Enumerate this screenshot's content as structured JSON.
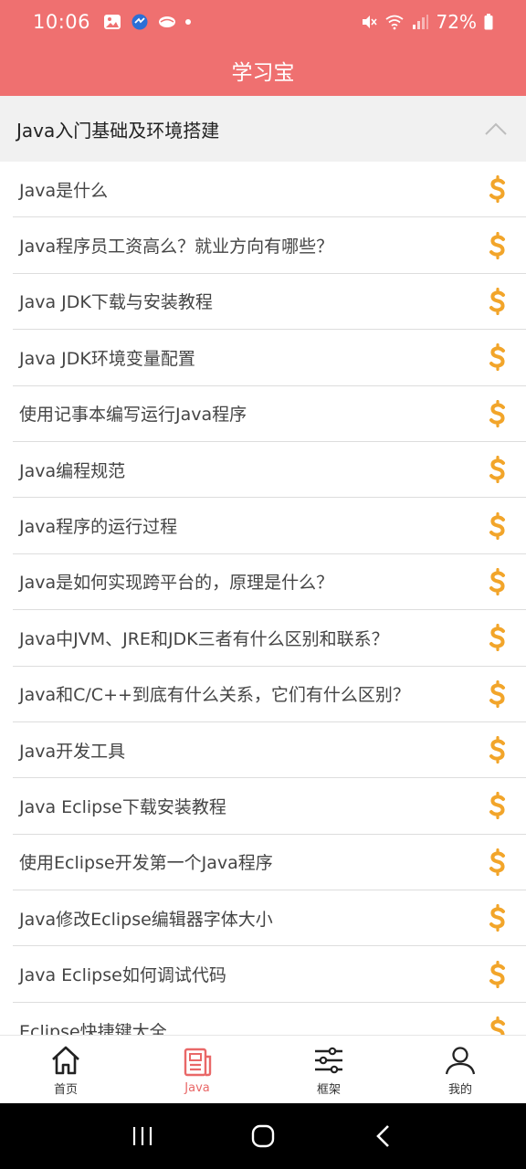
{
  "status_bar": {
    "time": "10:06",
    "battery": "72%"
  },
  "title": "学习宝",
  "section": {
    "title": "Java入门基础及环境搭建"
  },
  "items": [
    {
      "label": "Java是什么"
    },
    {
      "label": "Java程序员工资高么？就业方向有哪些？"
    },
    {
      "label": "Java JDK下载与安装教程"
    },
    {
      "label": "Java JDK环境变量配置"
    },
    {
      "label": "使用记事本编写运行Java程序"
    },
    {
      "label": "Java编程规范"
    },
    {
      "label": "Java程序的运行过程"
    },
    {
      "label": "Java是如何实现跨平台的，原理是什么？"
    },
    {
      "label": "Java中JVM、JRE和JDK三者有什么区别和联系？"
    },
    {
      "label": "Java和C/C++到底有什么关系，它们有什么区别？"
    },
    {
      "label": "Java开发工具"
    },
    {
      "label": "Java Eclipse下载安装教程"
    },
    {
      "label": "使用Eclipse开发第一个Java程序"
    },
    {
      "label": "Java修改Eclipse编辑器字体大小"
    },
    {
      "label": "Java Eclipse如何调试代码"
    },
    {
      "label": "Eclipse快捷键大全"
    }
  ],
  "bottom_nav": [
    {
      "label": "首页",
      "icon": "home-icon"
    },
    {
      "label": "Java",
      "icon": "document-icon"
    },
    {
      "label": "框架",
      "icon": "sliders-icon"
    },
    {
      "label": "我的",
      "icon": "person-icon"
    }
  ],
  "colors": {
    "header": "#ef7070",
    "coin": "#f2a52a",
    "active_nav": "#e96868"
  }
}
